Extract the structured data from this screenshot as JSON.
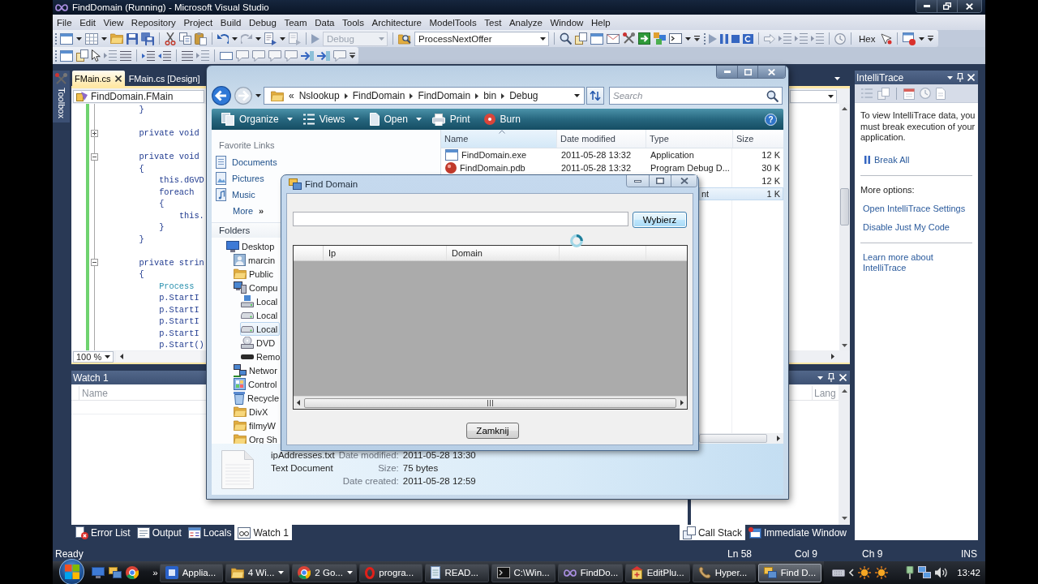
{
  "window": {
    "title": "FindDomain (Running) - Microsoft Visual Studio"
  },
  "menu": [
    "File",
    "Edit",
    "View",
    "Repository",
    "Project",
    "Build",
    "Debug",
    "Team",
    "Data",
    "Tools",
    "Architecture",
    "ModelTools",
    "Test",
    "Analyze",
    "Window",
    "Help"
  ],
  "toolbar": {
    "solution_configuration": {
      "value": "Debug",
      "disabled": true
    },
    "find_box": {
      "value": "ProcessNextOffer"
    },
    "hex_button": {
      "label": "Hex"
    }
  },
  "toolbox_tab": {
    "label": "Toolbox"
  },
  "editor": {
    "tabs": [
      {
        "label": "FMain.cs",
        "selected": true
      },
      {
        "label": "FMain.cs [Design]",
        "selected": false
      }
    ],
    "type_combo": {
      "value": "FindDomain.FMain"
    },
    "lines": [
      {
        "kind": "code",
        "text": "        }"
      },
      {
        "kind": "blank"
      },
      {
        "kind": "code",
        "text": "        private void",
        "expanded": false
      },
      {
        "kind": "blank"
      },
      {
        "kind": "code",
        "text": "        private void",
        "expanded": true
      },
      {
        "kind": "code",
        "text": "        {"
      },
      {
        "kind": "code",
        "text": "            this.dGVD"
      },
      {
        "kind": "code",
        "text": "            foreach"
      },
      {
        "kind": "code",
        "text": "            {"
      },
      {
        "kind": "code",
        "text": "                this."
      },
      {
        "kind": "code",
        "text": "            }"
      },
      {
        "kind": "code",
        "text": "        }"
      },
      {
        "kind": "blank"
      },
      {
        "kind": "code",
        "text": "        private strin",
        "expanded": true
      },
      {
        "kind": "code",
        "text": "        {"
      },
      {
        "kind": "type",
        "text": "            Process"
      },
      {
        "kind": "code",
        "text": "            p.StartI"
      },
      {
        "kind": "code",
        "text": "            p.StartI"
      },
      {
        "kind": "code",
        "text": "            p.StartI"
      },
      {
        "kind": "code",
        "text": "            p.StartI"
      },
      {
        "kind": "code",
        "text": "            p.Start()"
      }
    ],
    "zoom": {
      "value": "100 %"
    }
  },
  "explorer": {
    "address": {
      "overflow": "«",
      "path": [
        "Nslookup",
        "FindDomain",
        "FindDomain",
        "bin",
        "Debug"
      ]
    },
    "search": {
      "placeholder": "Search"
    },
    "commands": [
      {
        "label": "Organize",
        "menu": true
      },
      {
        "label": "Views",
        "menu": true
      },
      {
        "label": "Open",
        "menu": true
      },
      {
        "label": "Print",
        "menu": false
      },
      {
        "label": "Burn",
        "menu": false
      }
    ],
    "help_button": "?",
    "favorites": {
      "heading": "Favorite Links",
      "items": [
        {
          "label": "Documents",
          "kind": "documents"
        },
        {
          "label": "Pictures",
          "kind": "pictures"
        },
        {
          "label": "Music",
          "kind": "music"
        }
      ],
      "more": {
        "label": "More",
        "chevron": "»"
      }
    },
    "folders": {
      "heading": "Folders",
      "tree": [
        {
          "label": "Desktop",
          "kind": "desktop",
          "selected": false,
          "children": [
            {
              "label": "marcin",
              "kind": "user",
              "selected": false
            },
            {
              "label": "Public",
              "kind": "folder",
              "selected": false
            },
            {
              "label": "Compu",
              "kind": "computer",
              "selected": false,
              "children": [
                {
                  "label": "Local",
                  "kind": "system-drive",
                  "selected": false
                },
                {
                  "label": "Local",
                  "kind": "drive",
                  "selected": false
                },
                {
                  "label": "Local",
                  "kind": "drive",
                  "selected": true
                },
                {
                  "label": "DVD",
                  "kind": "dvd",
                  "selected": false
                },
                {
                  "label": "Remo",
                  "kind": "removable",
                  "selected": false
                }
              ]
            },
            {
              "label": "Networ",
              "kind": "network",
              "selected": false
            },
            {
              "label": "Control",
              "kind": "control",
              "selected": false
            },
            {
              "label": "Recycle",
              "kind": "recycle",
              "selected": false
            },
            {
              "label": "DivX",
              "kind": "folder",
              "selected": false
            },
            {
              "label": "filmyW",
              "kind": "folder",
              "selected": false
            },
            {
              "label": "Org Sh",
              "kind": "folder",
              "selected": false
            }
          ]
        }
      ]
    },
    "file_list": {
      "columns": [
        {
          "label": "Name",
          "sorted": true
        },
        {
          "label": "Date modified",
          "sorted": false
        },
        {
          "label": "Type",
          "sorted": false
        },
        {
          "label": "Size",
          "sorted": false
        }
      ],
      "rows": [
        {
          "kind": "exe",
          "name": "FindDomain.exe",
          "date_modified": "2011-05-28 13:32",
          "type": "Application",
          "size": "12 K",
          "selected": false
        },
        {
          "kind": "pdb",
          "name": "FindDomain.pdb",
          "date_modified": "2011-05-28 13:32",
          "type": "Program Debug D...",
          "size": "30 K",
          "selected": false
        },
        {
          "size": "12 K",
          "selected": false
        },
        {
          "type": "nt",
          "size": "1 K",
          "selected": true
        }
      ]
    },
    "details": {
      "name": "ipAddresses.txt",
      "type": "Text Document",
      "fields": [
        {
          "label": "Date modified:",
          "value": "2011-05-28 13:30"
        },
        {
          "label": "Size:",
          "value": "75 bytes"
        },
        {
          "label": "Date created:",
          "value": "2011-05-28 12:59"
        }
      ]
    }
  },
  "dialog": {
    "title": "Find Domain",
    "choose_button": {
      "label": "Wybierz",
      "focused": true
    },
    "grid": {
      "columns": [
        "Ip",
        "Domain"
      ]
    },
    "close_button": {
      "label": "Zamknij",
      "focused": false
    }
  },
  "watch_panel": {
    "title": "Watch 1",
    "columns": [
      "Name"
    ]
  },
  "watch_tabs": [
    {
      "label": "Error List",
      "kind": "errors",
      "selected": false
    },
    {
      "label": "Output",
      "kind": "output",
      "selected": false
    },
    {
      "label": "Locals",
      "kind": "locals",
      "selected": false
    },
    {
      "label": "Watch 1",
      "kind": "watch",
      "selected": true
    }
  ],
  "call_stack_panel": {
    "columns": [
      "Lang"
    ]
  },
  "call_stack_tabs": [
    {
      "label": "Call Stack",
      "kind": "stack",
      "selected": true
    },
    {
      "label": "Immediate Window",
      "kind": "immediate",
      "selected": false
    }
  ],
  "intellitrace": {
    "title": "IntelliTrace",
    "message": "To view IntelliTrace data, you must break execution of your application.",
    "break_link": "Break All",
    "more_heading": "More options:",
    "links": [
      "Open IntelliTrace Settings",
      "Disable Just My Code"
    ],
    "learn_link": "Learn more about IntelliTrace"
  },
  "status_bar": {
    "message": "Ready",
    "line": "Ln 58",
    "column": "Col 9",
    "char": "Ch 9",
    "mode": "INS"
  },
  "taskbar": {
    "quick_launch_more": "»",
    "tasks": [
      {
        "label": "Applia...",
        "kind": "app",
        "menu": false,
        "selected": false
      },
      {
        "label": "4 Wi...",
        "kind": "folder",
        "menu": true,
        "selected": false
      },
      {
        "label": "2 Go...",
        "kind": "browser",
        "menu": true,
        "selected": false
      },
      {
        "label": "progra...",
        "kind": "ring",
        "menu": false,
        "selected": false
      },
      {
        "label": "READ...",
        "kind": "notepad",
        "menu": false,
        "selected": false
      },
      {
        "label": "C:\\Win...",
        "kind": "console",
        "menu": false,
        "selected": false
      },
      {
        "label": "FindDo...",
        "kind": "infinity",
        "menu": false,
        "selected": false
      },
      {
        "label": "EditPlu...",
        "kind": "editor",
        "menu": false,
        "selected": false
      },
      {
        "label": "Hyper...",
        "kind": "terminal",
        "menu": false,
        "selected": false
      },
      {
        "label": "Find D...",
        "kind": "window",
        "menu": false,
        "selected": true
      }
    ],
    "clock": "13:42"
  }
}
